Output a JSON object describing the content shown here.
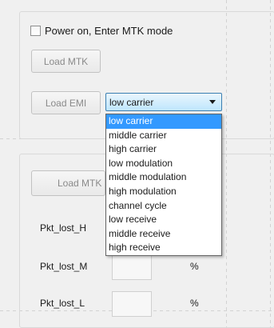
{
  "power_checkbox": {
    "label": "Power on, Enter MTK mode",
    "checked": false
  },
  "buttons": {
    "load_mtk": "Load MTK",
    "load_emi": "Load EMI",
    "load_mtk_2": "Load MTK"
  },
  "mode_combo": {
    "selected": "low carrier",
    "options": [
      "low carrier",
      "middle carrier",
      "high carrier",
      "low modulation",
      "middle modulation",
      "high modulation",
      "channel cycle",
      "low receive",
      "middle receive",
      "high receive"
    ]
  },
  "stats": {
    "pkt_lost_h": {
      "label": "Pkt_lost_H",
      "unit": "%"
    },
    "pkt_lost_m": {
      "label": "Pkt_lost_M",
      "unit": "%"
    },
    "pkt_lost_l": {
      "label": "Pkt_lost_L",
      "unit": "%"
    }
  },
  "colors": {
    "selection": "#3399ff",
    "combo_border": "#3c7fb1",
    "disabled_text": "#8a8a8a"
  }
}
